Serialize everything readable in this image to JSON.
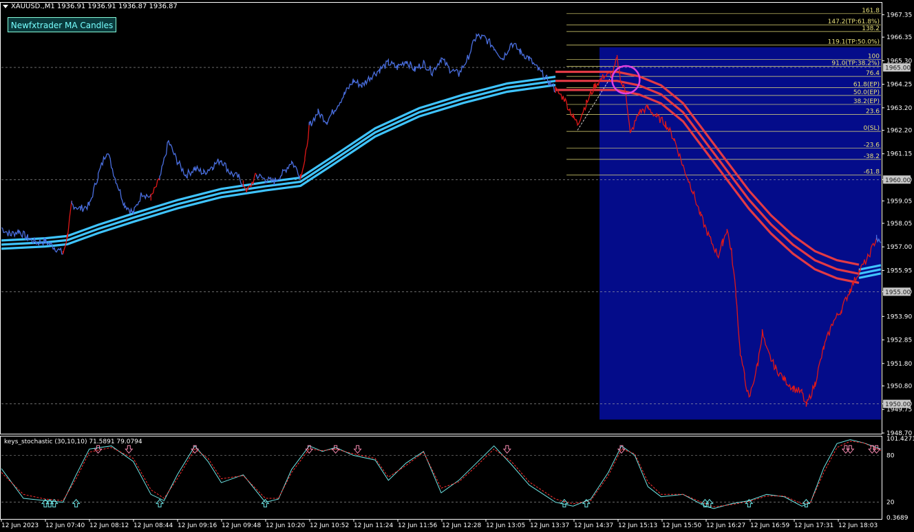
{
  "header": {
    "symbol_line": "XAUUSD.,M1  1936.91 1936.91 1936.87 1936.87",
    "indicator_button": "Newfxtrader MA Candles"
  },
  "colors": {
    "background": "#000000",
    "bull": "#4a6fe0",
    "bear": "#e01818",
    "ma": "#3fc4ff",
    "ma_bear": "#e23a45",
    "fib": "#e8e07a",
    "zone": "#040c8a",
    "circle": "#e040e0",
    "stoch_main": "#6fe8e8",
    "stoch_signal": "#ff3030"
  },
  "chart_data": [
    {
      "type": "candlestick-line",
      "title": "",
      "y_ticks": [
        "1967.35",
        "1966.35",
        "1965.30",
        "1964.25",
        "1963.20",
        "1962.20",
        "1961.15",
        "1960.00",
        "1959.05",
        "1958.05",
        "1957.00",
        "1955.95",
        "1955.00",
        "1953.90",
        "1952.85",
        "1951.80",
        "1950.80",
        "1950.00",
        "1949.75",
        "1948.70"
      ],
      "ylim": [
        1948.7,
        1967.7
      ],
      "current_price_labels": [
        "1965.00",
        "1960.00",
        "1955.00",
        "1950.00"
      ],
      "x_ticks": [
        "12 Jun 2023",
        "12 Jun 07:40",
        "12 Jun 08:12",
        "12 Jun 08:44",
        "12 Jun 09:16",
        "12 Jun 09:48",
        "12 Jun 10:20",
        "12 Jun 10:52",
        "12 Jun 11:24",
        "12 Jun 11:56",
        "12 Jun 12:28",
        "12 Jun 13:05",
        "12 Jun 13:37",
        "12 Jun 14:37",
        "12 Jun 15:13",
        "12 Jun 15:50",
        "12 Jun 16:27",
        "12 Jun 16:59",
        "12 Jun 17:31",
        "12 Jun 18:03"
      ],
      "price_path": [
        [
          0,
          1957.85
        ],
        [
          2,
          1957.55
        ],
        [
          4,
          1957.7
        ],
        [
          6,
          1957.4
        ],
        [
          8,
          1957.2
        ],
        [
          10,
          1957.25
        ],
        [
          12,
          1957.0
        ],
        [
          14,
          1956.7
        ],
        [
          15,
          1957.5
        ],
        [
          16,
          1958.9
        ],
        [
          18,
          1958.7
        ],
        [
          20,
          1958.85
        ],
        [
          22,
          1960.2
        ],
        [
          24,
          1961.3
        ],
        [
          26,
          1960.0
        ],
        [
          28,
          1958.9
        ],
        [
          30,
          1958.5
        ],
        [
          32,
          1959.4
        ],
        [
          34,
          1959.2
        ],
        [
          36,
          1960.0
        ],
        [
          38,
          1961.7
        ],
        [
          40,
          1960.8
        ],
        [
          42,
          1960.2
        ],
        [
          44,
          1960.5
        ],
        [
          46,
          1960.3
        ],
        [
          48,
          1960.6
        ],
        [
          50,
          1960.9
        ],
        [
          52,
          1960.3
        ],
        [
          54,
          1960.1
        ],
        [
          55,
          1959.8
        ],
        [
          56,
          1959.5
        ],
        [
          58,
          1960.2
        ],
        [
          60,
          1960.0
        ],
        [
          62,
          1959.9
        ],
        [
          64,
          1960.3
        ],
        [
          66,
          1960.8
        ],
        [
          68,
          1960.2
        ],
        [
          69,
          1960.8
        ],
        [
          70,
          1962.4
        ],
        [
          72,
          1963.0
        ],
        [
          74,
          1962.6
        ],
        [
          76,
          1963.2
        ],
        [
          78,
          1963.8
        ],
        [
          80,
          1964.4
        ],
        [
          82,
          1964.2
        ],
        [
          84,
          1964.6
        ],
        [
          86,
          1964.9
        ],
        [
          88,
          1965.2
        ],
        [
          90,
          1965.0
        ],
        [
          92,
          1965.3
        ],
        [
          94,
          1964.9
        ],
        [
          96,
          1965.2
        ],
        [
          98,
          1964.8
        ],
        [
          100,
          1965.4
        ],
        [
          102,
          1964.9
        ],
        [
          104,
          1964.7
        ],
        [
          106,
          1965.4
        ],
        [
          108,
          1966.4
        ],
        [
          110,
          1966.3
        ],
        [
          112,
          1965.9
        ],
        [
          114,
          1965.4
        ],
        [
          116,
          1966.1
        ],
        [
          118,
          1965.7
        ],
        [
          120,
          1965.4
        ],
        [
          122,
          1964.9
        ],
        [
          124,
          1964.5
        ],
        [
          126,
          1964.0
        ],
        [
          128,
          1963.6
        ],
        [
          130,
          1962.8
        ],
        [
          131,
          1962.5
        ],
        [
          133,
          1963.4
        ],
        [
          135,
          1964.2
        ],
        [
          137,
          1964.6
        ],
        [
          139,
          1964.7
        ],
        [
          140,
          1965.4
        ],
        [
          141,
          1964.3
        ],
        [
          142,
          1963.9
        ],
        [
          143,
          1962.0
        ],
        [
          145,
          1963.0
        ],
        [
          147,
          1963.2
        ],
        [
          149,
          1962.8
        ],
        [
          151,
          1962.5
        ],
        [
          153,
          1961.8
        ],
        [
          155,
          1960.6
        ],
        [
          157,
          1959.6
        ],
        [
          159,
          1958.4
        ],
        [
          161,
          1957.4
        ],
        [
          163,
          1956.6
        ],
        [
          164,
          1957.2
        ],
        [
          165,
          1957.8
        ],
        [
          166,
          1956.8
        ],
        [
          167,
          1955.0
        ],
        [
          168,
          1952.3
        ],
        [
          169,
          1951.2
        ],
        [
          170,
          1950.2
        ],
        [
          172,
          1951.8
        ],
        [
          173,
          1953.2
        ],
        [
          174,
          1952.4
        ],
        [
          176,
          1951.6
        ],
        [
          178,
          1951.1
        ],
        [
          180,
          1950.7
        ],
        [
          182,
          1950.5
        ],
        [
          183,
          1949.9
        ],
        [
          185,
          1950.9
        ],
        [
          187,
          1952.5
        ],
        [
          189,
          1953.6
        ],
        [
          191,
          1954.2
        ],
        [
          193,
          1955.1
        ],
        [
          195,
          1955.9
        ],
        [
          197,
          1956.5
        ],
        [
          199,
          1957.4
        ],
        [
          200,
          1957.1
        ]
      ],
      "bear_ranges": [
        [
          13,
          15
        ],
        [
          33,
          34
        ],
        [
          55,
          57
        ],
        [
          68,
          69
        ],
        [
          126,
          140
        ],
        [
          141,
          197
        ]
      ],
      "ma_path": [
        [
          0,
          1957.1
        ],
        [
          10,
          1957.2
        ],
        [
          15,
          1957.3
        ],
        [
          22,
          1957.8
        ],
        [
          30,
          1958.3
        ],
        [
          40,
          1958.9
        ],
        [
          50,
          1959.4
        ],
        [
          60,
          1959.7
        ],
        [
          68,
          1959.9
        ],
        [
          75,
          1960.8
        ],
        [
          85,
          1962.1
        ],
        [
          95,
          1963.0
        ],
        [
          105,
          1963.6
        ],
        [
          115,
          1964.1
        ],
        [
          126,
          1964.4
        ],
        [
          135,
          1964.4
        ],
        [
          140,
          1964.4
        ],
        [
          145,
          1964.2
        ],
        [
          150,
          1963.8
        ],
        [
          155,
          1963.0
        ],
        [
          160,
          1961.7
        ],
        [
          165,
          1960.4
        ],
        [
          170,
          1959.1
        ],
        [
          175,
          1958.0
        ],
        [
          180,
          1957.1
        ],
        [
          185,
          1956.4
        ],
        [
          190,
          1956.0
        ],
        [
          195,
          1955.8
        ],
        [
          200,
          1956.0
        ]
      ],
      "ma_bear_ranges": [
        [
          126,
          193
        ]
      ],
      "fib_levels": [
        {
          "label": "161.8",
          "price": 1967.4
        },
        {
          "label": "147.2(TP:61.8%)",
          "price": 1966.9
        },
        {
          "label": "138.2",
          "price": 1966.6
        },
        {
          "label": "119.1(TP:50.0%)",
          "price": 1966.0
        },
        {
          "label": "100",
          "price": 1965.35
        },
        {
          "label": "91.0(TP:38.2%)",
          "price": 1965.05
        },
        {
          "label": "76.4",
          "price": 1964.6
        },
        {
          "label": "61.8(EP)",
          "price": 1964.1
        },
        {
          "label": "50.0(EP)",
          "price": 1963.75
        },
        {
          "label": "38.2(EP)",
          "price": 1963.35
        },
        {
          "label": "23.6",
          "price": 1962.9
        },
        {
          "label": "0(SL)",
          "price": 1962.15
        },
        {
          "label": "-23.6",
          "price": 1961.4
        },
        {
          "label": "-38.2",
          "price": 1960.9
        },
        {
          "label": "-61.8",
          "price": 1960.2
        }
      ],
      "zone": {
        "x_from": 136,
        "x_to": 200,
        "price_top": 1965.9,
        "price_bottom": 1949.3
      },
      "highlight_circle": {
        "x": 142,
        "price": 1964.45
      },
      "trend_line": {
        "from": [
          131,
          1962.2
        ],
        "to": [
          139,
          1964.7
        ]
      }
    },
    {
      "type": "line",
      "title": "keys_stochastic (30,10,10) 71.5891 79.0794",
      "y_ticks": [
        "101.4271",
        "80",
        "20",
        "0.3689"
      ],
      "ylim": [
        0.3689,
        101.4271
      ],
      "series": [
        {
          "name": "main",
          "values": [
            [
              0,
              63
            ],
            [
              5,
              25
            ],
            [
              10,
              22
            ],
            [
              14,
              20
            ],
            [
              17,
              55
            ],
            [
              20,
              88
            ],
            [
              25,
              92
            ],
            [
              30,
              72
            ],
            [
              34,
              30
            ],
            [
              37,
              22
            ],
            [
              40,
              55
            ],
            [
              44,
              92
            ],
            [
              47,
              72
            ],
            [
              50,
              45
            ],
            [
              55,
              55
            ],
            [
              60,
              20
            ],
            [
              63,
              24
            ],
            [
              66,
              62
            ],
            [
              70,
              92
            ],
            [
              73,
              85
            ],
            [
              76,
              90
            ],
            [
              80,
              80
            ],
            [
              85,
              74
            ],
            [
              88,
              48
            ],
            [
              92,
              70
            ],
            [
              96,
              85
            ],
            [
              100,
              32
            ],
            [
              104,
              48
            ],
            [
              108,
              70
            ],
            [
              112,
              92
            ],
            [
              116,
              68
            ],
            [
              120,
              42
            ],
            [
              126,
              20
            ],
            [
              130,
              15
            ],
            [
              134,
              24
            ],
            [
              138,
              58
            ],
            [
              141,
              92
            ],
            [
              144,
              80
            ],
            [
              147,
              40
            ],
            [
              150,
              27
            ],
            [
              155,
              30
            ],
            [
              160,
              15
            ],
            [
              162,
              12
            ],
            [
              166,
              18
            ],
            [
              170,
              22
            ],
            [
              174,
              30
            ],
            [
              178,
              27
            ],
            [
              182,
              15
            ],
            [
              184,
              20
            ],
            [
              187,
              64
            ],
            [
              190,
              95
            ],
            [
              193,
              100
            ],
            [
              196,
              96
            ],
            [
              200,
              88
            ]
          ]
        },
        {
          "name": "signal",
          "values": [
            [
              0,
              58
            ],
            [
              5,
              30
            ],
            [
              10,
              24
            ],
            [
              14,
              22
            ],
            [
              17,
              50
            ],
            [
              20,
              84
            ],
            [
              25,
              90
            ],
            [
              30,
              76
            ],
            [
              34,
              36
            ],
            [
              37,
              25
            ],
            [
              40,
              50
            ],
            [
              44,
              88
            ],
            [
              47,
              76
            ],
            [
              50,
              50
            ],
            [
              55,
              54
            ],
            [
              60,
              25
            ],
            [
              63,
              25
            ],
            [
              66,
              58
            ],
            [
              70,
              88
            ],
            [
              73,
              86
            ],
            [
              76,
              88
            ],
            [
              80,
              82
            ],
            [
              85,
              76
            ],
            [
              88,
              52
            ],
            [
              92,
              67
            ],
            [
              96,
              84
            ],
            [
              100,
              38
            ],
            [
              104,
              46
            ],
            [
              108,
              66
            ],
            [
              112,
              88
            ],
            [
              116,
              72
            ],
            [
              120,
              46
            ],
            [
              126,
              24
            ],
            [
              130,
              18
            ],
            [
              134,
              22
            ],
            [
              138,
              54
            ],
            [
              141,
              88
            ],
            [
              144,
              82
            ],
            [
              147,
              46
            ],
            [
              150,
              30
            ],
            [
              155,
              30
            ],
            [
              160,
              18
            ],
            [
              162,
              14
            ],
            [
              166,
              17
            ],
            [
              170,
              21
            ],
            [
              174,
              28
            ],
            [
              178,
              28
            ],
            [
              182,
              18
            ],
            [
              184,
              20
            ],
            [
              187,
              58
            ],
            [
              190,
              90
            ],
            [
              193,
              98
            ],
            [
              196,
              96
            ],
            [
              200,
              86
            ]
          ]
        }
      ],
      "arrows_up": [
        10,
        11,
        12,
        17,
        36,
        60,
        128,
        133,
        160,
        161,
        170,
        183
      ],
      "arrows_down": [
        22,
        29,
        44,
        70,
        76,
        81,
        115,
        141,
        192,
        193,
        198,
        199
      ]
    }
  ]
}
